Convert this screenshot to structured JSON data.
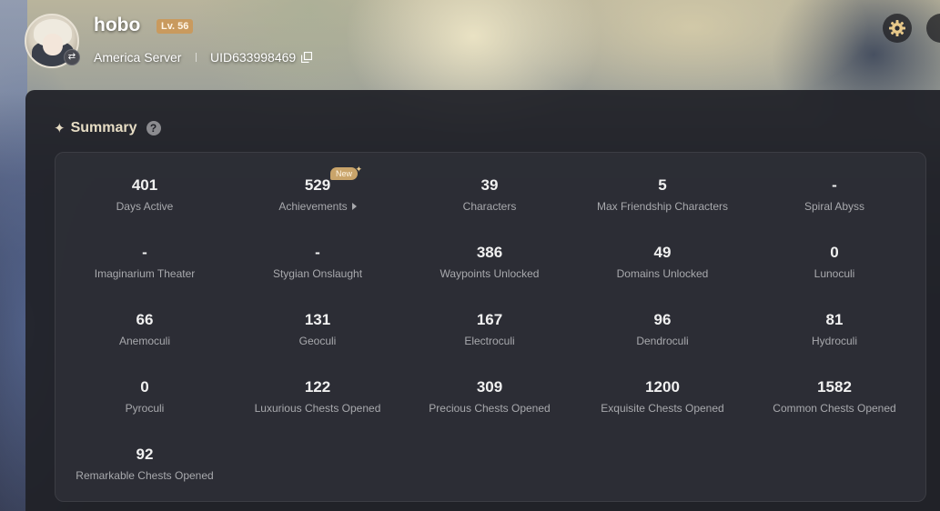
{
  "profile": {
    "username": "hobo",
    "level": "Lv. 56",
    "server": "America Server",
    "uid": "UID633998469"
  },
  "summary": {
    "title": "Summary",
    "help_glyph": "?",
    "new_badge": "New",
    "stats": [
      {
        "value": "401",
        "label": "Days Active"
      },
      {
        "value": "529",
        "label": "Achievements"
      },
      {
        "value": "39",
        "label": "Characters"
      },
      {
        "value": "5",
        "label": "Max Friendship Characters"
      },
      {
        "value": "-",
        "label": "Spiral Abyss"
      },
      {
        "value": "-",
        "label": "Imaginarium Theater"
      },
      {
        "value": "-",
        "label": "Stygian Onslaught"
      },
      {
        "value": "386",
        "label": "Waypoints Unlocked"
      },
      {
        "value": "49",
        "label": "Domains Unlocked"
      },
      {
        "value": "0",
        "label": "Lunoculi"
      },
      {
        "value": "66",
        "label": "Anemoculi"
      },
      {
        "value": "131",
        "label": "Geoculi"
      },
      {
        "value": "167",
        "label": "Electroculi"
      },
      {
        "value": "96",
        "label": "Dendroculi"
      },
      {
        "value": "81",
        "label": "Hydroculi"
      },
      {
        "value": "0",
        "label": "Pyroculi"
      },
      {
        "value": "122",
        "label": "Luxurious Chests Opened"
      },
      {
        "value": "309",
        "label": "Precious Chests Opened"
      },
      {
        "value": "1200",
        "label": "Exquisite Chests Opened"
      },
      {
        "value": "1582",
        "label": "Common Chests Opened"
      },
      {
        "value": "92",
        "label": "Remarkable Chests Opened"
      }
    ]
  },
  "icons": {
    "settings": "gear-icon",
    "copy": "copy-icon",
    "help": "help-icon",
    "swap": "swap-icon",
    "star": "sparkle-icon"
  },
  "colors": {
    "accent_gold": "#c99a5e",
    "panel_bg": "#212228",
    "stat_value": "#f1f1f1",
    "stat_label": "#a8a9ad"
  }
}
